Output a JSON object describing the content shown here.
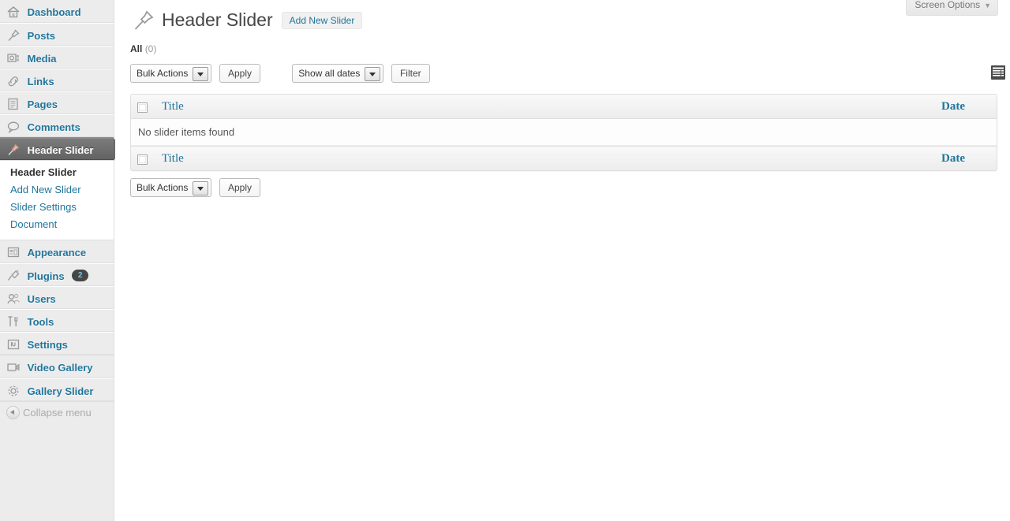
{
  "sidebar": {
    "groups": [
      {
        "items": [
          {
            "label": "Dashboard",
            "icon": "dashboard-icon",
            "name": "sidebar-item-dashboard",
            "current": false
          },
          {
            "label": "Posts",
            "icon": "pin-icon",
            "name": "sidebar-item-posts",
            "current": false
          },
          {
            "label": "Media",
            "icon": "media-icon",
            "name": "sidebar-item-media",
            "current": false
          },
          {
            "label": "Links",
            "icon": "link-icon",
            "name": "sidebar-item-links",
            "current": false
          },
          {
            "label": "Pages",
            "icon": "pages-icon",
            "name": "sidebar-item-pages",
            "current": false
          },
          {
            "label": "Comments",
            "icon": "comment-icon",
            "name": "sidebar-item-comments",
            "current": false
          },
          {
            "label": "Header Slider",
            "icon": "pin-icon",
            "name": "sidebar-item-header-slider",
            "current": true
          }
        ]
      }
    ],
    "submenu": [
      {
        "label": "Header Slider",
        "name": "submenu-item-header-slider",
        "current": true
      },
      {
        "label": "Add New Slider",
        "name": "submenu-item-add-new-slider",
        "current": false
      },
      {
        "label": "Slider Settings",
        "name": "submenu-item-slider-settings",
        "current": false
      },
      {
        "label": "Document",
        "name": "submenu-item-document",
        "current": false
      }
    ],
    "group2": [
      {
        "label": "Appearance",
        "icon": "appearance-icon",
        "name": "sidebar-item-appearance",
        "badge": null
      },
      {
        "label": "Plugins",
        "icon": "plugin-icon",
        "name": "sidebar-item-plugins",
        "badge": "2"
      },
      {
        "label": "Users",
        "icon": "users-icon",
        "name": "sidebar-item-users",
        "badge": null
      },
      {
        "label": "Tools",
        "icon": "tools-icon",
        "name": "sidebar-item-tools",
        "badge": null
      },
      {
        "label": "Settings",
        "icon": "settings-icon",
        "name": "sidebar-item-settings",
        "badge": null
      }
    ],
    "group3": [
      {
        "label": "Video Gallery",
        "icon": "video-icon",
        "name": "sidebar-item-video-gallery"
      },
      {
        "label": "Gallery Slider",
        "icon": "gear-icon",
        "name": "sidebar-item-gallery-slider"
      }
    ],
    "collapse_label": "Collapse menu"
  },
  "header": {
    "screen_options_label": "Screen Options",
    "screen_options_caret": "▼",
    "page_title": "Header Slider",
    "add_new_label": "Add New Slider"
  },
  "filters": {
    "all_label": "All",
    "all_count": "(0)"
  },
  "toolbar_top": {
    "bulk_actions_label": "Bulk Actions",
    "apply_label": "Apply",
    "dates_label": "Show all dates",
    "filter_label": "Filter"
  },
  "toolbar_bottom": {
    "bulk_actions_label": "Bulk Actions",
    "apply_label": "Apply"
  },
  "view_switch": {
    "list_view": "list-view-icon",
    "excerpt_view": "excerpt-view-icon"
  },
  "table": {
    "columns": {
      "title": "Title",
      "date": "Date"
    },
    "empty_message": "No slider items found"
  },
  "colors": {
    "link": "#21759b",
    "sidebar_bg": "#ececec",
    "current_item_bg": "#6d6d6d",
    "badge_bg": "#464646",
    "badge_text": "#7ec1e4",
    "title_text": "#464646"
  }
}
